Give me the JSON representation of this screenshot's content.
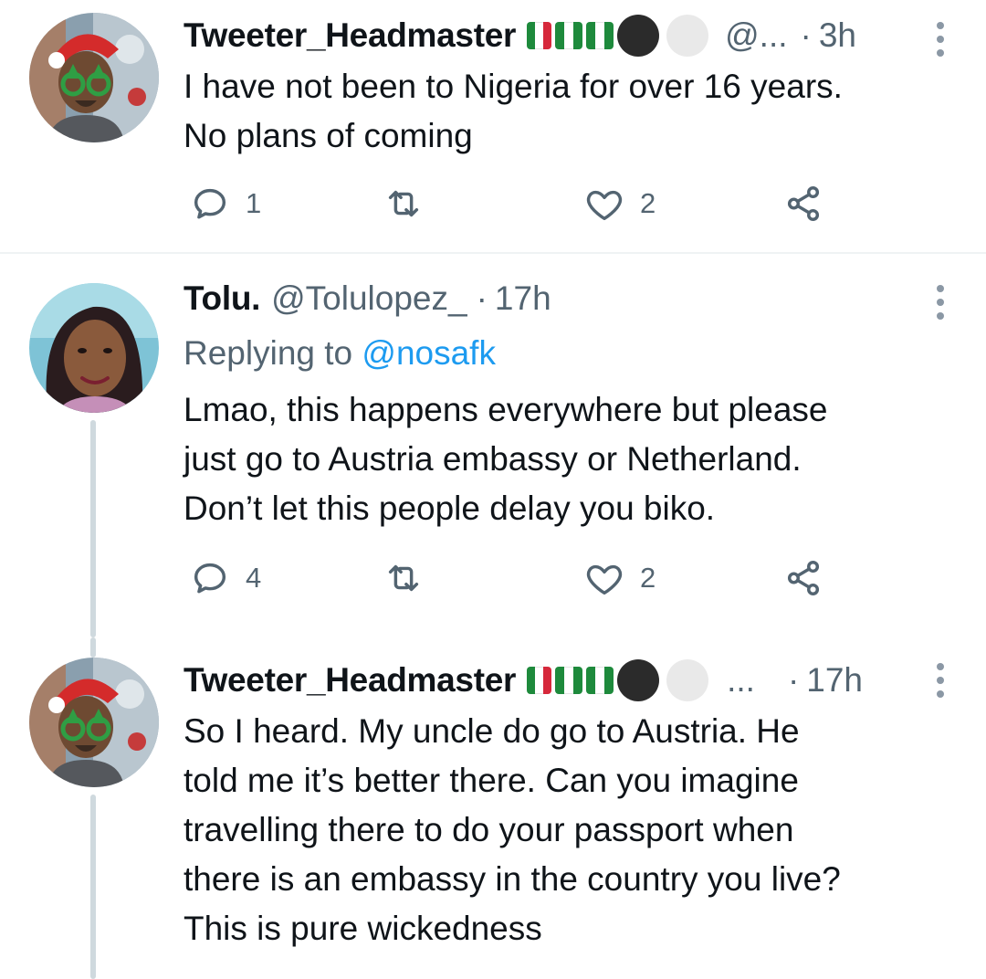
{
  "tweets": [
    {
      "name": "Tweeter_Headmaster",
      "handle": "@...",
      "dot": "·",
      "time": "3h",
      "reply_prefix": "",
      "reply_mention": "",
      "lines": [
        "I have not been to Nigeria for over 16 years.",
        "No plans of coming"
      ],
      "replies": "1",
      "retweets": "",
      "likes": "2"
    },
    {
      "name": "Tolu.",
      "handle": "@Tolulopez_",
      "dot": "·",
      "time": "17h",
      "reply_prefix": "Replying to ",
      "reply_mention": "@nosafk",
      "lines": [
        "Lmao, this happens everywhere but please",
        "just go to Austria embassy or Netherland.",
        "Don’t let this people delay you biko."
      ],
      "replies": "4",
      "retweets": "",
      "likes": "2"
    },
    {
      "name": "Tweeter_Headmaster",
      "handle": "...",
      "dot": "·",
      "time": "17h",
      "reply_prefix": "",
      "reply_mention": "",
      "lines": [
        "So I heard. My uncle do go to Austria. He",
        "told me it’s better there. Can you imagine",
        "travelling there to do your passport when",
        "there is an embassy in the country you live?",
        "This is pure wickedness"
      ],
      "replies": "",
      "retweets": "",
      "likes": ""
    }
  ],
  "icons": {
    "reply": "reply-icon",
    "retweet": "retweet-icon",
    "like": "heart-icon",
    "share": "share-icon",
    "more": "more-vertical-icon"
  },
  "colors": {
    "text": "#0f1419",
    "secondary": "#536471",
    "link": "#1d9bf0",
    "thread_line": "#cfd9de"
  }
}
